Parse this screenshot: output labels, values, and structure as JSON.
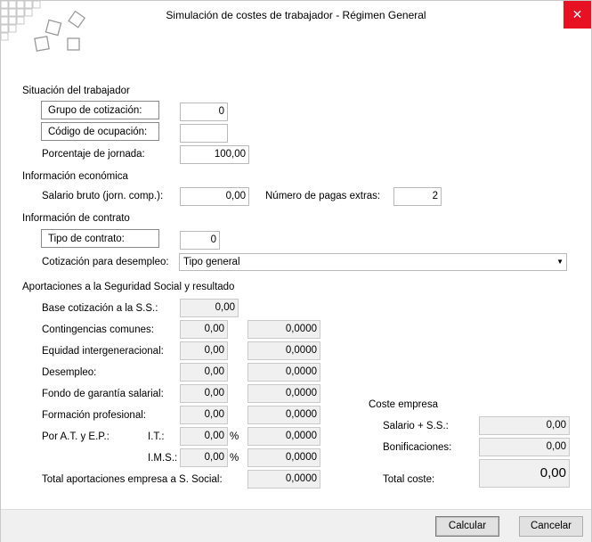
{
  "window": {
    "title": "Simulación de costes de trabajador - Régimen General",
    "close": "✕"
  },
  "worker": {
    "heading": "Situación del trabajador",
    "grupo_label": "Grupo de cotización:",
    "grupo_value": "0",
    "codigo_label": "Código de ocupación:",
    "codigo_value": "",
    "porcentaje_label": "Porcentaje de jornada:",
    "porcentaje_value": "100,00"
  },
  "economic": {
    "heading": "Información económica",
    "salario_label": "Salario bruto (jorn. comp.):",
    "salario_value": "0,00",
    "pagas_label": "Número de pagas extras:",
    "pagas_value": "2"
  },
  "contract": {
    "heading": "Información de contrato",
    "tipo_label": "Tipo de contrato:",
    "tipo_value": "0",
    "desempleo_label": "Cotización para desempleo:",
    "desempleo_value": "Tipo general"
  },
  "ss": {
    "heading": "Aportaciones a la Seguridad Social y resultado",
    "base_label": "Base cotización a la S.S.:",
    "base_value": "0,00",
    "rows": [
      {
        "label": "Contingencias comunes:",
        "pct": "0,00",
        "amount": "0,0000"
      },
      {
        "label": "Equidad intergeneracional:",
        "pct": "0,00",
        "amount": "0,0000"
      },
      {
        "label": "Desempleo:",
        "pct": "0,00",
        "amount": "0,0000"
      },
      {
        "label": "Fondo de garantía salarial:",
        "pct": "0,00",
        "amount": "0,0000"
      },
      {
        "label": "Formación profesional:",
        "pct": "0,00",
        "amount": "0,0000"
      }
    ],
    "at_label": "Por A.T. y E.P.:",
    "it_label": "I.T.:",
    "it_pct": "0,00",
    "it_amount": "0,0000",
    "ims_label": "I.M.S.:",
    "ims_pct": "0,00",
    "ims_amount": "0,0000",
    "pct_sign": "%",
    "total_label": "Total aportaciones empresa a S. Social:",
    "total_value": "0,0000"
  },
  "cost": {
    "heading": "Coste empresa",
    "salario_ss_label": "Salario + S.S.:",
    "salario_ss_value": "0,00",
    "bonif_label": "Bonificaciones:",
    "bonif_value": "0,00",
    "total_label": "Total coste:",
    "total_value": "0,00"
  },
  "footer": {
    "calcular": "Calcular",
    "cancelar": "Cancelar"
  },
  "colors": {
    "close_bg": "#e81123",
    "readonly_bg": "#f0f0f0",
    "footer_bg": "#f0f0f0"
  },
  "icons": {
    "logo": "squares-logo-icon",
    "dropdown": "chevron-down-icon",
    "close": "close-icon"
  }
}
